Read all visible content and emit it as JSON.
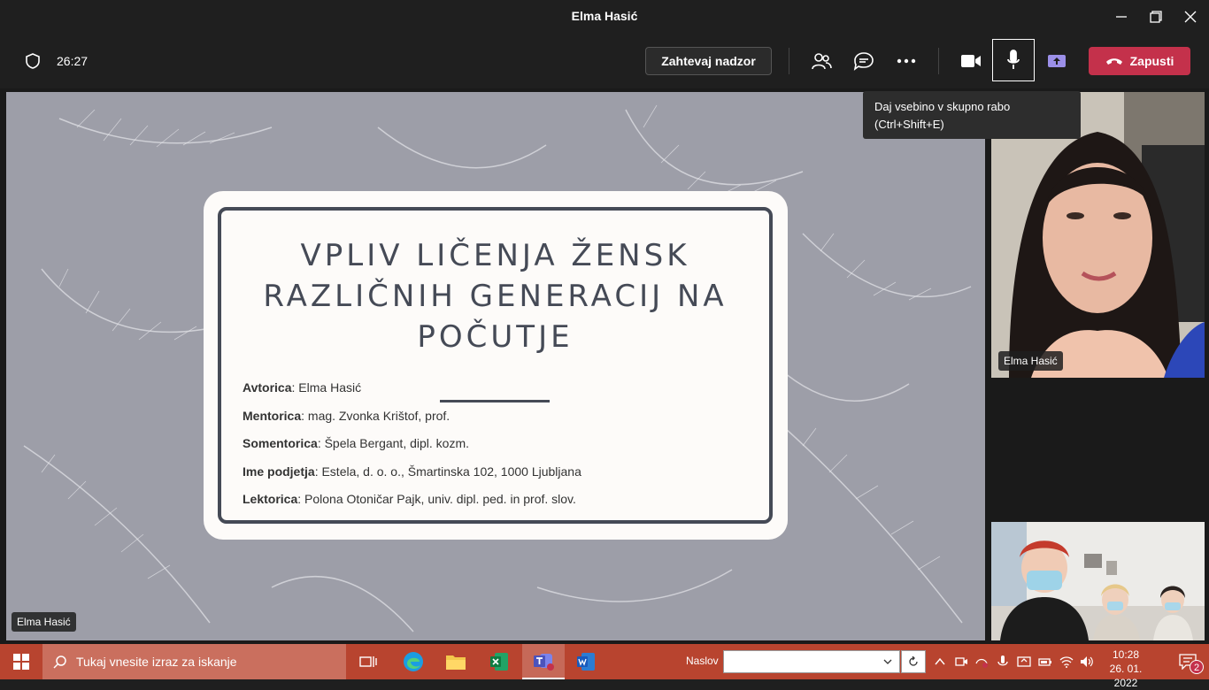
{
  "window": {
    "title": "Elma Hasić"
  },
  "toolbar": {
    "timer": "26:27",
    "request_control_label": "Zahtevaj nadzor",
    "leave_label": "Zapusti"
  },
  "tooltip": {
    "line1": "Daj vsebino v skupno rabo",
    "line2": "(Ctrl+Shift+E)"
  },
  "slide": {
    "title_lines": [
      "VPLIV LIČENJA ŽENSK",
      "RAZLIČNIH GENERACIJ NA",
      "POČUTJE"
    ],
    "info": [
      {
        "label": "Avtorica",
        "value": ": Elma Hasić"
      },
      {
        "label": "Mentorica",
        "value": ": mag. Zvonka Krištof, prof."
      },
      {
        "label": "Somentorica",
        "value": ": Špela Bergant, dipl. kozm."
      },
      {
        "label": "Ime podjetja",
        "value": ": Estela, d. o. o., Šmartinska 102, 1000 Ljubljana"
      },
      {
        "label": "Lektorica",
        "value": ": Polona Otoničar Pajk, univ. dipl. ped. in prof. slov."
      }
    ],
    "presenter_tag": "Elma Hasić"
  },
  "participants": [
    {
      "name": "Elma Hasić"
    }
  ],
  "taskbar": {
    "search_placeholder": "Tukaj vnesite izraz za iskanje",
    "naslov_label": "Naslov",
    "time": "10:28",
    "date": "26. 01. 2022",
    "notification_count": "2"
  },
  "colors": {
    "accent_leave": "#c4314b",
    "taskbar": "#b8442f",
    "slide_bg": "#9d9ea8",
    "slide_text": "#454a56"
  }
}
